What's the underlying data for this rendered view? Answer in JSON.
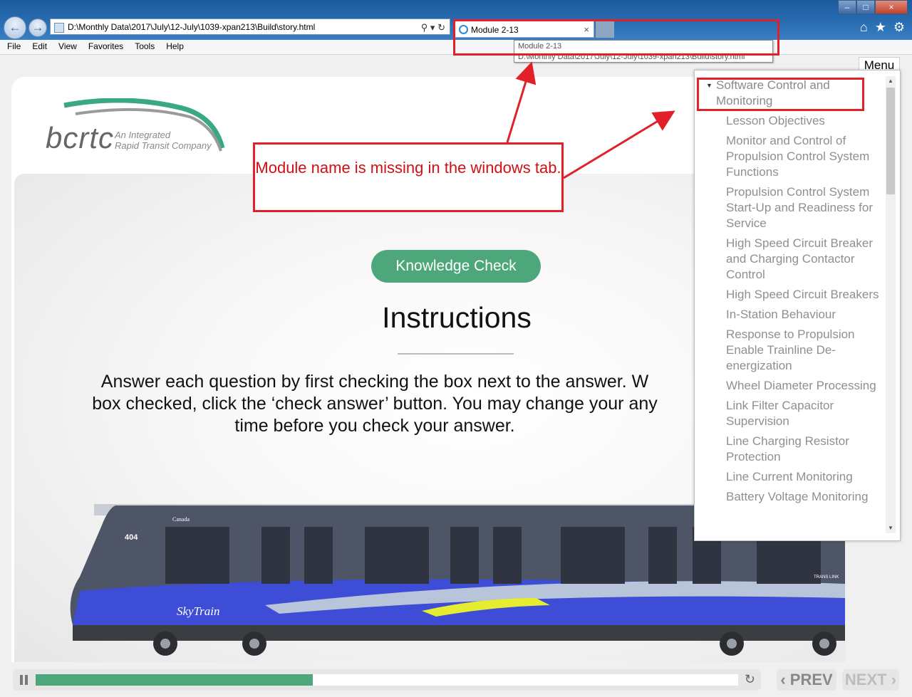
{
  "browser": {
    "address": "D:\\Monthly Data\\2017\\July\\12-July\\1039-xpan213\\Build\\story.html",
    "tab_title": "Module 2-13",
    "tab_close": "×",
    "tooltip_title": "Module 2-13",
    "tooltip_path": "D:\\Monthly Data\\2017\\July\\12-July\\1039-xpan213\\Build\\story.html",
    "window_buttons": {
      "minimize": "–",
      "maximize": "□",
      "close": "×"
    },
    "icons": [
      "back-icon",
      "forward-icon",
      "search-icon",
      "refresh-icon",
      "home-icon",
      "favorites-star-icon",
      "settings-gear-icon"
    ]
  },
  "menubar": [
    "File",
    "Edit",
    "View",
    "Favorites",
    "Tools",
    "Help"
  ],
  "logo": {
    "name": "bcrtc",
    "tagline_1": "An Integrated",
    "tagline_2": "Rapid Transit Company"
  },
  "slide": {
    "badge": "Knowledge Check",
    "heading": "Instructions",
    "body": "Answer each question by first checking the box next to the answer. W box checked, click the ‘check answer’ button. You may change your any time before you check your answer."
  },
  "train": {
    "number": "404",
    "brand": "SkyTrain",
    "country": "Canada",
    "operator": "TRANS LINK"
  },
  "player": {
    "progress": 0.395,
    "prev_label": "PREV",
    "next_label": "NEXT"
  },
  "menu": {
    "label": "Menu",
    "section": "Software Control and Monitoring",
    "items": [
      "Lesson Objectives",
      "Monitor and Control of Propulsion Control System Functions",
      "Propulsion Control System Start-Up and Readiness for Service",
      "High Speed Circuit Breaker and Charging Contactor Control",
      "High Speed Circuit Breakers",
      "In-Station Behaviour",
      "Response to Propulsion Enable Trainline De-energization",
      "Wheel Diameter Processing",
      "Link Filter Capacitor Supervision",
      "Line Charging Resistor Protection",
      "Line Current Monitoring",
      "Battery Voltage Monitoring"
    ]
  },
  "annotation": {
    "callout": "Module name is missing in the windows tab.",
    "color": "#e2202a"
  }
}
